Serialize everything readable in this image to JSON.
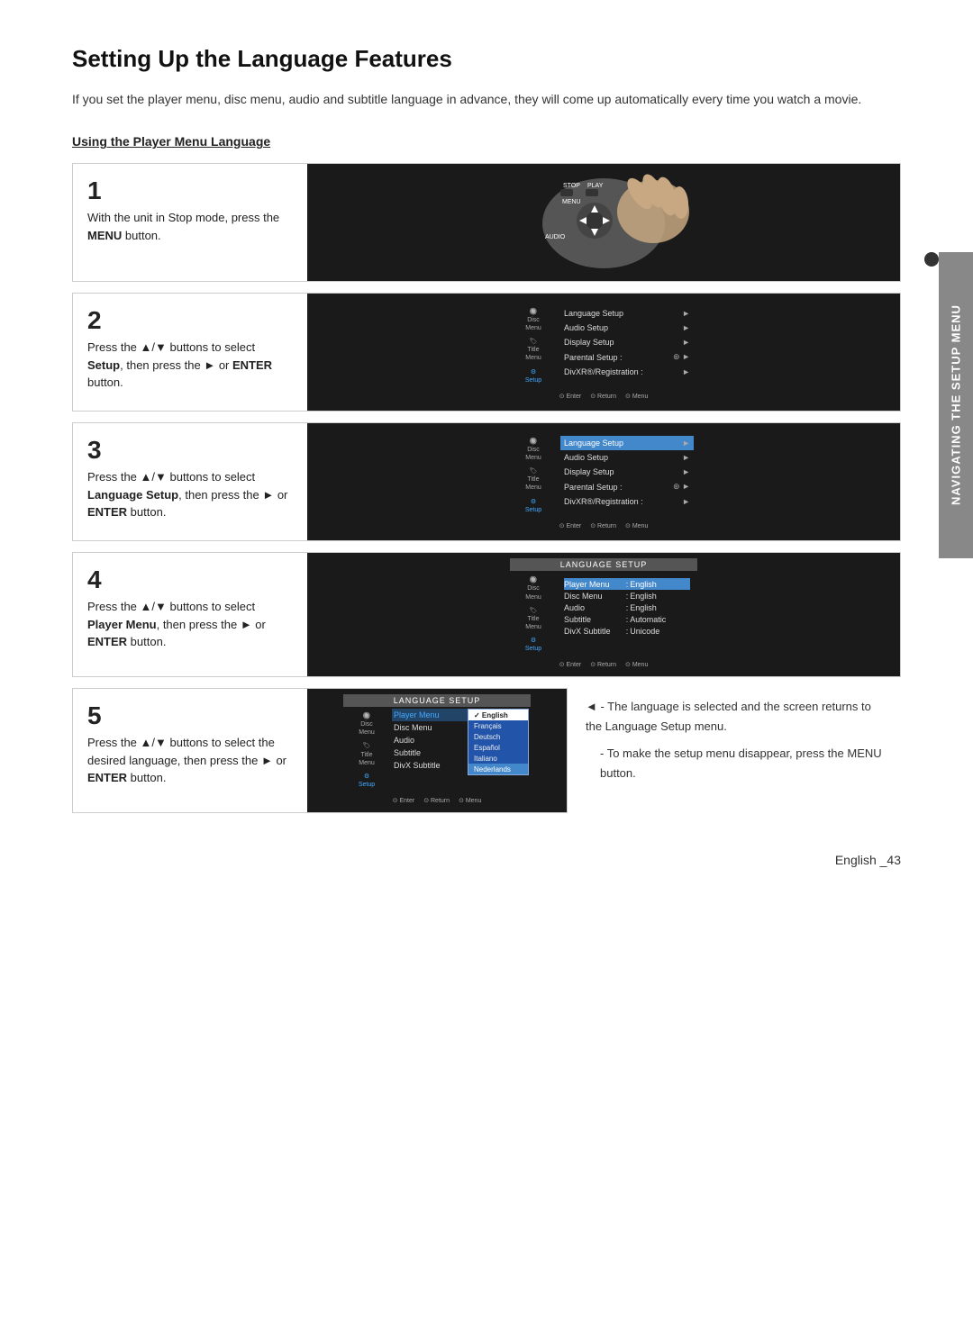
{
  "page": {
    "title": "Setting Up the Language Features",
    "intro": "If you set the player menu, disc menu, audio and subtitle language in advance, they will come up automatically every time you watch a movie.",
    "section_heading": "Using the Player Menu Language",
    "page_number": "English _43",
    "side_tab_label": "NAVIGATING THE SETUP MENU"
  },
  "steps": [
    {
      "number": "1",
      "text": "With the unit in Stop mode, press the ",
      "text_bold": "MENU",
      "text_after": " button.",
      "image_type": "remote"
    },
    {
      "number": "2",
      "text_html": "Press the ▲/▼ buttons to select Setup, then press the ► or ENTER button.",
      "image_type": "screen_menu",
      "screen_title": "",
      "menu_items": [
        {
          "label": "Language Setup",
          "arrow": "►",
          "highlighted": false
        },
        {
          "label": "Audio Setup",
          "arrow": "►",
          "highlighted": false
        },
        {
          "label": "Display Setup",
          "arrow": "►",
          "highlighted": false
        },
        {
          "label": "Parental Setup :",
          "arrow": "⊛ ►",
          "highlighted": false
        },
        {
          "label": "DivXR®/Registration :",
          "arrow": "►",
          "highlighted": false
        }
      ],
      "sidebar_icons": [
        "Disc Menu",
        "Title Menu",
        "Setup"
      ],
      "active_sidebar": 2
    },
    {
      "number": "3",
      "text_html": "Press the ▲/▼ buttons to select Language Setup, then press the ► or ENTER button.",
      "image_type": "screen_menu",
      "screen_title": "",
      "menu_items": [
        {
          "label": "Language Setup",
          "arrow": "►",
          "highlighted": true
        },
        {
          "label": "Audio Setup",
          "arrow": "►",
          "highlighted": false
        },
        {
          "label": "Display Setup",
          "arrow": "►",
          "highlighted": false
        },
        {
          "label": "Parental Setup :",
          "arrow": "⊛ ►",
          "highlighted": false
        },
        {
          "label": "DivXR®/Registration :",
          "arrow": "►",
          "highlighted": false
        }
      ],
      "sidebar_icons": [
        "Disc Menu",
        "Title Menu",
        "Setup"
      ],
      "active_sidebar": 2
    },
    {
      "number": "4",
      "text_html": "Press the ▲/▼ buttons to select Player Menu, then press the ► or ENTER  button.",
      "image_type": "lang_setup",
      "screen_title": "LANGUAGE SETUP",
      "lang_rows": [
        {
          "label": "Player Menu",
          "colon": ":",
          "value": "English",
          "highlighted": true
        },
        {
          "label": "Disc Menu",
          "colon": ":",
          "value": "English",
          "highlighted": false
        },
        {
          "label": "Audio",
          "colon": ":",
          "value": "English",
          "highlighted": false
        },
        {
          "label": "Subtitle",
          "colon": ":",
          "value": "Automatic",
          "highlighted": false
        },
        {
          "label": "DivX Subtitle",
          "colon": ":",
          "value": "Unicode",
          "highlighted": false
        }
      ],
      "sidebar_icons": [
        "Disc Menu",
        "Title Menu",
        "Setup"
      ],
      "active_sidebar": 2
    },
    {
      "number": "5",
      "text_html": "Press the ▲/▼ buttons to select the desired language, then press the ► or ENTER button.",
      "image_type": "lang_setup_dropdown",
      "screen_title": "LANGUAGE SETUP",
      "lang_rows_left": [
        {
          "label": "Player Menu",
          "highlighted": true
        },
        {
          "label": "Disc Menu",
          "highlighted": false
        },
        {
          "label": "Audio",
          "highlighted": false
        },
        {
          "label": "Subtitle",
          "highlighted": false
        },
        {
          "label": "DivX Subtitle",
          "highlighted": false
        }
      ],
      "dropdown_items": [
        {
          "label": "English",
          "active": false,
          "selected_blue": false,
          "check": "✓"
        },
        {
          "label": "Français",
          "active": false,
          "selected_blue": false
        },
        {
          "label": "Deutsch",
          "active": false,
          "selected_blue": false
        },
        {
          "label": "Español",
          "active": false,
          "selected_blue": false
        },
        {
          "label": "Italiano",
          "active": false,
          "selected_blue": false
        },
        {
          "label": "Nederlands",
          "active": true,
          "selected_blue": true
        }
      ],
      "sidebar_icons": [
        "Disc Menu",
        "Title Menu",
        "Setup"
      ],
      "active_sidebar": 2
    }
  ],
  "step5_notes": [
    "- The language is selected and the screen returns to the Language Setup menu.",
    "- To make the setup menu disappear, press the MENU button."
  ],
  "footer_icons": [
    "⊙ Enter",
    "⊙ Return",
    "⊙ Menu"
  ]
}
